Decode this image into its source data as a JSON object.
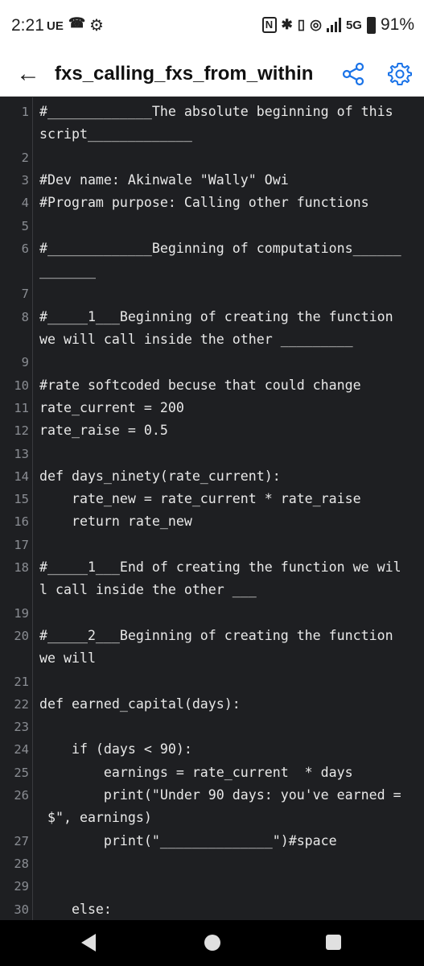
{
  "status_bar": {
    "time": "2:21",
    "carrier": "UE",
    "missed_call_icon": "missed-call-icon",
    "settings_icon": "gear-icon",
    "nfc_label": "N",
    "network": "5G",
    "battery_percent": "91%"
  },
  "app_bar": {
    "title": "fxs_calling_fxs_from_within",
    "back_icon": "arrow-left-icon",
    "share_icon": "share-icon",
    "settings_icon": "gear-icon"
  },
  "editor": {
    "rows": [
      {
        "ln": "1",
        "text": "#_____________The absolute beginning of this"
      },
      {
        "ln": "",
        "text": "script_____________"
      },
      {
        "ln": "2",
        "text": ""
      },
      {
        "ln": "3",
        "text": "#Dev name: Akinwale \"Wally\" Owi"
      },
      {
        "ln": "4",
        "text": "#Program purpose: Calling other functions"
      },
      {
        "ln": "5",
        "text": ""
      },
      {
        "ln": "6",
        "text": "#_____________Beginning of computations______"
      },
      {
        "ln": "",
        "text": "_______"
      },
      {
        "ln": "7",
        "text": ""
      },
      {
        "ln": "8",
        "text": "#_____1___Beginning of creating the function"
      },
      {
        "ln": "",
        "text": "we will call inside the other _________"
      },
      {
        "ln": "9",
        "text": ""
      },
      {
        "ln": "10",
        "text": "#rate softcoded becuse that could change"
      },
      {
        "ln": "11",
        "text": "rate_current = 200"
      },
      {
        "ln": "12",
        "text": "rate_raise = 0.5"
      },
      {
        "ln": "13",
        "text": ""
      },
      {
        "ln": "14",
        "text": "def days_ninety(rate_current):"
      },
      {
        "ln": "15",
        "text": "    rate_new = rate_current * rate_raise"
      },
      {
        "ln": "16",
        "text": "    return rate_new"
      },
      {
        "ln": "17",
        "text": ""
      },
      {
        "ln": "18",
        "text": "#_____1___End of creating the function we wil"
      },
      {
        "ln": "",
        "text": "l call inside the other ___"
      },
      {
        "ln": "19",
        "text": ""
      },
      {
        "ln": "20",
        "text": "#_____2___Beginning of creating the function"
      },
      {
        "ln": "",
        "text": "we will"
      },
      {
        "ln": "21",
        "text": ""
      },
      {
        "ln": "22",
        "text": "def earned_capital(days):"
      },
      {
        "ln": "23",
        "text": ""
      },
      {
        "ln": "24",
        "text": "    if (days < 90):"
      },
      {
        "ln": "25",
        "text": "        earnings = rate_current  * days"
      },
      {
        "ln": "26",
        "text": "        print(\"Under 90 days: you've earned ="
      },
      {
        "ln": "",
        "text": " $\", earnings)"
      },
      {
        "ln": "27",
        "text": "        print(\"______________\")#space"
      },
      {
        "ln": "28",
        "text": ""
      },
      {
        "ln": "29",
        "text": ""
      },
      {
        "ln": "30",
        "text": "    else:"
      }
    ]
  },
  "nav_bar": {
    "back_icon": "nav-back-icon",
    "home_icon": "nav-home-icon",
    "recents_icon": "nav-recents-icon"
  }
}
